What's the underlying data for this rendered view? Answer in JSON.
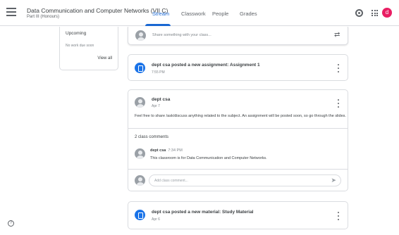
{
  "header": {
    "class_title": "Data Communication and Computer Networks (VII C)",
    "class_subtitle": "Part III (Honours)",
    "tabs": [
      {
        "label": "Stream"
      },
      {
        "label": "Classwork"
      },
      {
        "label": "People"
      },
      {
        "label": "Grades"
      }
    ],
    "active_tab": "Stream",
    "user_initial": "d",
    "user_avatar_color": "#e91e63",
    "accent_color": "#1967d2"
  },
  "upcoming": {
    "title": "Upcoming",
    "empty_text": "No work due soon",
    "view_all": "View all"
  },
  "share": {
    "placeholder": "Share something with your class..."
  },
  "posts": [
    {
      "title": "dept csa posted a new assignment: Assignment 1",
      "time": "7:55 PM",
      "icon": "assignment-icon"
    },
    {
      "author": "dept csa",
      "time": "Apr 7",
      "body": "Feel free to share /ask/discuss anything related to the subject. An assignment will be posted soon, so go through the slides.",
      "comments_count": "2 class comments",
      "comment": {
        "author": "dept csa",
        "time": "7:34 PM",
        "text": "This classroom is for Data Communication and Computer Networks."
      },
      "comment_placeholder": "Add class comment..."
    },
    {
      "title": "dept csa posted a new material: Study Material",
      "time": "Apr 6",
      "icon": "material-icon"
    }
  ],
  "help": "?"
}
